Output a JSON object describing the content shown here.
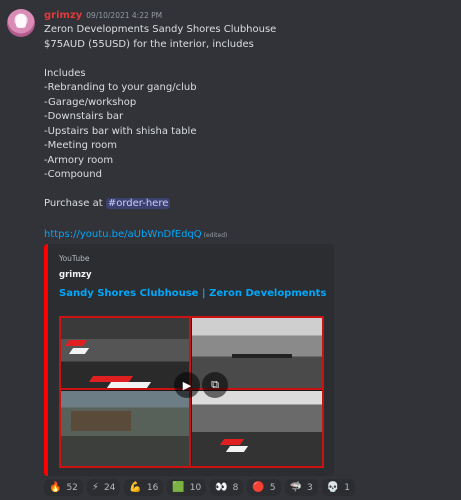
{
  "message": {
    "username": "grimzy",
    "timestamp": "09/10/2021 4:22 PM",
    "lines": [
      "Zeron Developments Sandy Shores Clubhouse",
      "$75AUD (55USD) for the interior, includes",
      "",
      "Includes",
      "-Rebranding to your gang/club",
      "-Garage/workshop",
      "-Downstairs bar",
      "-Upstairs bar with shisha table",
      "-Meeting room",
      "-Armory room",
      "-Compound",
      ""
    ],
    "purchase_prefix": "Purchase at ",
    "purchase_channel": "#order-here",
    "link": "https://youtu.be/aUbWnDfEdqQ",
    "edited": "(edited)"
  },
  "embed": {
    "provider": "YouTube",
    "author": "grimzy",
    "title": "Sandy Shores Clubhouse | Zeron Developments",
    "border_color": "#ff0000"
  },
  "reactions": [
    {
      "icon": "fire-emoji",
      "glyph": "🔥",
      "count": "52"
    },
    {
      "icon": "sparkles-emoji",
      "glyph": "⚡",
      "count": "24"
    },
    {
      "icon": "muscle-emoji",
      "glyph": "💪",
      "count": "16"
    },
    {
      "icon": "green-emoji",
      "glyph": "🟩",
      "count": "10"
    },
    {
      "icon": "eyes-emoji",
      "glyph": "👀",
      "count": "8"
    },
    {
      "icon": "red-dot-emoji",
      "glyph": "🔴",
      "count": "5"
    },
    {
      "icon": "shark-emoji",
      "glyph": "🦈",
      "count": "3"
    },
    {
      "icon": "skull-emoji",
      "glyph": "💀",
      "count": "1"
    }
  ]
}
